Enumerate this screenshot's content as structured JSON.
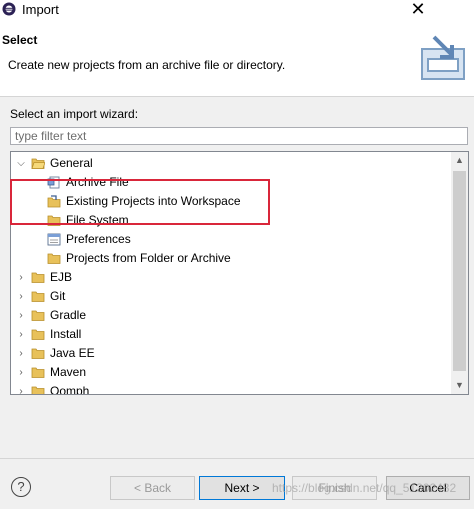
{
  "window": {
    "title": "Import"
  },
  "header": {
    "title": "Select",
    "description": "Create new projects from an archive file or directory."
  },
  "wizard_label": "Select an import wizard:",
  "filter": {
    "placeholder": "type filter text",
    "value": ""
  },
  "tree": {
    "items": [
      {
        "label": "General",
        "level": 0,
        "expanded": true,
        "icon": "folder-open-icon"
      },
      {
        "label": "Archive File",
        "level": 1,
        "icon": "archive-file-icon"
      },
      {
        "label": "Existing Projects into Workspace",
        "level": 1,
        "icon": "existing-projects-icon",
        "selected": true
      },
      {
        "label": "File System",
        "level": 1,
        "icon": "folder-icon"
      },
      {
        "label": "Preferences",
        "level": 1,
        "icon": "preferences-icon"
      },
      {
        "label": "Projects from Folder or Archive",
        "level": 1,
        "icon": "folder-icon"
      },
      {
        "label": "EJB",
        "level": 0,
        "expanded": false,
        "icon": "folder-icon"
      },
      {
        "label": "Git",
        "level": 0,
        "expanded": false,
        "icon": "folder-icon"
      },
      {
        "label": "Gradle",
        "level": 0,
        "expanded": false,
        "icon": "folder-icon"
      },
      {
        "label": "Install",
        "level": 0,
        "expanded": false,
        "icon": "folder-icon"
      },
      {
        "label": "Java EE",
        "level": 0,
        "expanded": false,
        "icon": "folder-icon"
      },
      {
        "label": "Maven",
        "level": 0,
        "expanded": false,
        "icon": "folder-icon"
      },
      {
        "label": "Oomph",
        "level": 0,
        "expanded": false,
        "icon": "folder-icon"
      }
    ]
  },
  "buttons": {
    "back": "< Back",
    "next": "Next >",
    "finish": "Finish",
    "cancel": "Cancel"
  },
  "watermark": "https://blog.csdn.net/qq_51302432",
  "colors": {
    "highlight": "#d9263a",
    "folder": "#e8c15a"
  }
}
